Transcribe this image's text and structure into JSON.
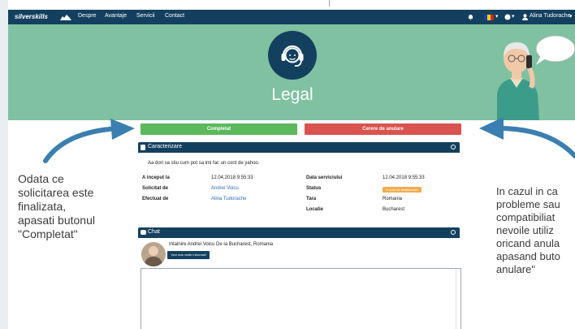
{
  "navbar": {
    "brand": "silverskills",
    "links": [
      "Despre",
      "Avantaje",
      "Servicii",
      "Contact"
    ],
    "user_name": "Alina Tudorache"
  },
  "banner": {
    "title": "Legal"
  },
  "actions": {
    "complete_label": "Completat",
    "cancel_label": "Cerere de anulare"
  },
  "details": {
    "title": "Caracterizare",
    "description": "Aa dori sa stiu cum pot sa imi fac un cont de yahoo.",
    "left": [
      {
        "label": "A inceput la",
        "value": "12.04.2018 9:55:33"
      },
      {
        "label": "Solicitat de",
        "value": "Andrei Voicu"
      },
      {
        "label": "Efectuat de",
        "value": "Alina Tudorache"
      }
    ],
    "right": [
      {
        "label": "Data serviciului",
        "value": "12.04.2018 9:55:33"
      },
      {
        "label": "Status",
        "value": "in curs de desfasurare"
      },
      {
        "label": "Tara",
        "value": "Romania"
      },
      {
        "label": "Locatie",
        "value": "Bucharest"
      }
    ]
  },
  "chat": {
    "title": "Chat",
    "meeting_text": "Intalnire Andrei Voicu De la Bucharest, Romania",
    "more_info_label": "Vezi mai multe informatii"
  },
  "annotations": {
    "left_lines": [
      "Odata ce",
      "solicitarea este",
      "finalizata,",
      "apasati butonul",
      "\"Completat\""
    ],
    "right_lines": [
      "In cazul in ca",
      "probleme sau",
      "compatibiliat",
      "nevoile utiliz",
      "oricand anula",
      "apasand buto",
      "anulare\""
    ]
  },
  "colors": {
    "navy": "#13405f",
    "banner_green": "#7fc1a0",
    "complete_green": "#5cb85c",
    "cancel_red": "#d9534f",
    "status_orange": "#f0ad4e",
    "annotation_arrow": "#3b7fb0"
  },
  "icons": [
    "headset-icon",
    "bell-icon",
    "flag-icon",
    "globe-icon",
    "user-icon",
    "document-icon",
    "info-icon",
    "chat-icon",
    "calendar-icon",
    "map-pin-icon"
  ]
}
